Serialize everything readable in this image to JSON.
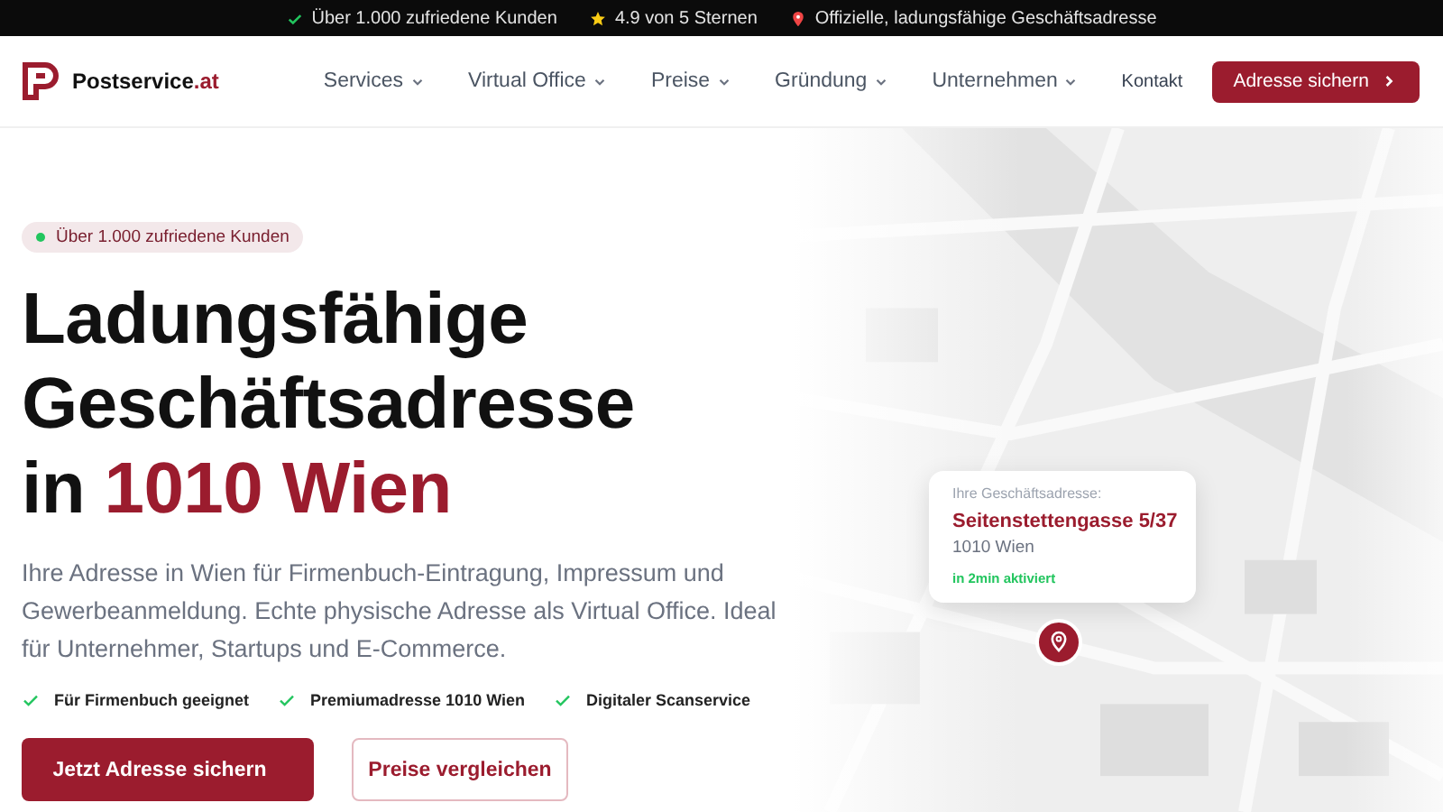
{
  "top_bar": {
    "items": [
      {
        "kind": "check",
        "text": "Über 1.000 zufriedene Kunden"
      },
      {
        "kind": "star",
        "text": "4.9 von 5 Sternen"
      },
      {
        "kind": "pin",
        "text": "Offizielle, ladungsfähige Geschäftsadresse"
      }
    ]
  },
  "nav": {
    "logo": {
      "name": "Postservice",
      "suffix": ".at"
    },
    "links": [
      {
        "label": "Services",
        "dropdown": true
      },
      {
        "label": "Virtual Office",
        "dropdown": true
      },
      {
        "label": "Preise",
        "dropdown": true
      },
      {
        "label": "Gründung",
        "dropdown": true
      },
      {
        "label": "Unternehmen",
        "dropdown": true
      }
    ],
    "contact": "Kontakt",
    "cta": "Adresse sichern"
  },
  "hero": {
    "badge": "Über 1.000 zufriedene Kunden",
    "heading": {
      "lines": [
        "Ladungsfähige",
        "Geschäftsadresse"
      ],
      "tail": "in",
      "accent": "1010 Wien"
    },
    "text": "Ihre Adresse in Wien für Firmenbuch-Eintragung, Impressum und Gewerbeanmeldung. Echte physische Adresse als Virtual Office. Ideal für Unternehmer, Startups und E-Commerce.",
    "features": [
      "Für Firmenbuch geeignet",
      "Premiumadresse 1010 Wien",
      "Digitaler Scanservice"
    ],
    "buttons": [
      {
        "label": "Jetzt Adresse sichern",
        "kind": "primary"
      },
      {
        "label": "Preise vergleichen",
        "kind": "secondary"
      }
    ]
  },
  "map_card": {
    "label": "Ihre Geschäftsadresse:",
    "street": "Seitenstettengasse 5/37",
    "city": "1010 Wien",
    "status": "in 2min aktiviert"
  }
}
